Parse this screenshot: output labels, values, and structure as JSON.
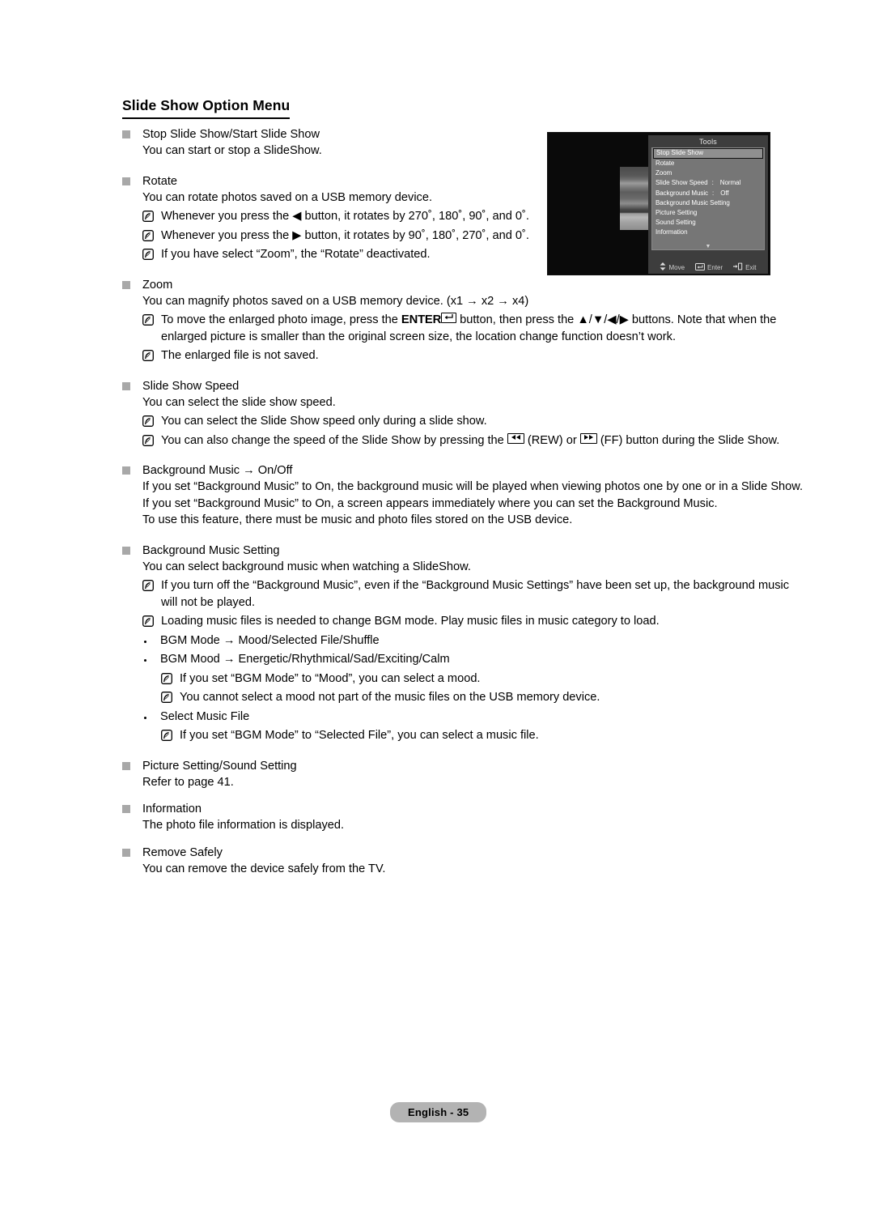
{
  "document": {
    "title": "Slide Show Option Menu",
    "footer_label": "English - 35"
  },
  "sections": [
    {
      "heading": "Stop Slide Show/Start Slide Show",
      "lines": [
        "You can start or stop a SlideShow."
      ]
    },
    {
      "heading": "Rotate",
      "lines": [
        "You can rotate photos saved on a USB memory device."
      ],
      "notes": [
        "Whenever you press the ◀ button, it rotates by 270˚, 180˚, 90˚, and 0˚.",
        "Whenever you press the ▶ button, it rotates by 90˚, 180˚, 270˚, and 0˚.",
        "If you have select “Zoom”, the “Rotate” deactivated."
      ]
    },
    {
      "heading": "Zoom",
      "lines": [
        "You can magnify photos saved on a USB memory device. (x1 → x2 → x4)"
      ],
      "notes_rich": {
        "note1_pre": "To move the enlarged photo image, press the ",
        "note1_enter": "ENTER",
        "note1_post": " button, then press the ▲/▼/◀/▶ buttons. Note that when the enlarged picture is smaller than the original screen size, the location change function doesn’t work.",
        "note2": "The enlarged file is not saved."
      }
    },
    {
      "heading": "Slide Show Speed",
      "lines": [
        "You can select the slide show speed."
      ],
      "notes": [
        "You can select the Slide Show speed only during a slide show."
      ],
      "note_rich": {
        "pre": "You can also change the speed of the Slide Show by pressing the ",
        "mid": " (REW) or ",
        "post": " (FF) button during the Slide Show."
      }
    },
    {
      "heading": "Background Music → On/Off",
      "lines": [
        "If you set “Background Music” to On, the background music will be played when viewing photos one by one or in a Slide Show.",
        "If you set “Background Music” to On, a screen appears immediately where you can set the Background Music.",
        "To use this feature, there must be music and photo files stored on the USB device."
      ]
    },
    {
      "heading": "Background Music Setting",
      "lines": [
        "You can select background music when watching a SlideShow."
      ],
      "notes": [
        "If you turn off the “Background Music”, even if the “Background Music Settings” have been set up, the background music will not be played.",
        "Loading music files is needed to change BGM mode. Play music files in music category to load."
      ],
      "bullets": [
        {
          "text": "BGM Mode → Mood/Selected File/Shuffle",
          "subnotes": []
        },
        {
          "text": "BGM Mood → Energetic/Rhythmical/Sad/Exciting/Calm",
          "subnotes": [
            "If you set “BGM Mode” to “Mood”, you can select a mood.",
            "You cannot select a mood not part of the music files on the USB memory device."
          ]
        },
        {
          "text": "Select Music File",
          "subnotes": [
            "If you set “BGM Mode” to “Selected File”, you can select a music file."
          ]
        }
      ]
    },
    {
      "heading": "Picture Setting/Sound Setting",
      "lines": [
        "Refer to page 41."
      ]
    },
    {
      "heading": "Information",
      "lines": [
        "The photo file information is displayed."
      ]
    },
    {
      "heading": "Remove Safely",
      "lines": [
        "You can remove the device safely from the TV."
      ]
    }
  ],
  "tv_menu": {
    "title": "Tools",
    "items": [
      {
        "label": "Stop Slide Show",
        "colon": "",
        "value": "",
        "selected": true
      },
      {
        "label": "Rotate",
        "colon": "",
        "value": "",
        "selected": false
      },
      {
        "label": "Zoom",
        "colon": "",
        "value": "",
        "selected": false
      },
      {
        "label": "Slide Show Speed",
        "colon": ":",
        "value": "Normal",
        "selected": false
      },
      {
        "label": "Background Music",
        "colon": ":",
        "value": "Off",
        "selected": false
      },
      {
        "label": "Background Music Setting",
        "colon": "",
        "value": "",
        "selected": false
      },
      {
        "label": "Picture Setting",
        "colon": "",
        "value": "",
        "selected": false
      },
      {
        "label": "Sound Setting",
        "colon": "",
        "value": "",
        "selected": false
      },
      {
        "label": "Information",
        "colon": "",
        "value": "",
        "selected": false
      }
    ],
    "scroll_caret": "▼",
    "footer": [
      {
        "icon": "updown-arrow-icon",
        "label": "Move"
      },
      {
        "icon": "enter-key-icon",
        "label": "Enter"
      },
      {
        "icon": "exit-key-icon",
        "label": "Exit"
      }
    ]
  },
  "colors": {
    "bullet_square": "#a8a8a8",
    "footer_pill_bg": "#b3b3b3",
    "tv_panel_bg": "#3d3d3d",
    "tv_list_bg": "#767676",
    "tv_selected_bg": "#8f8f8f"
  }
}
